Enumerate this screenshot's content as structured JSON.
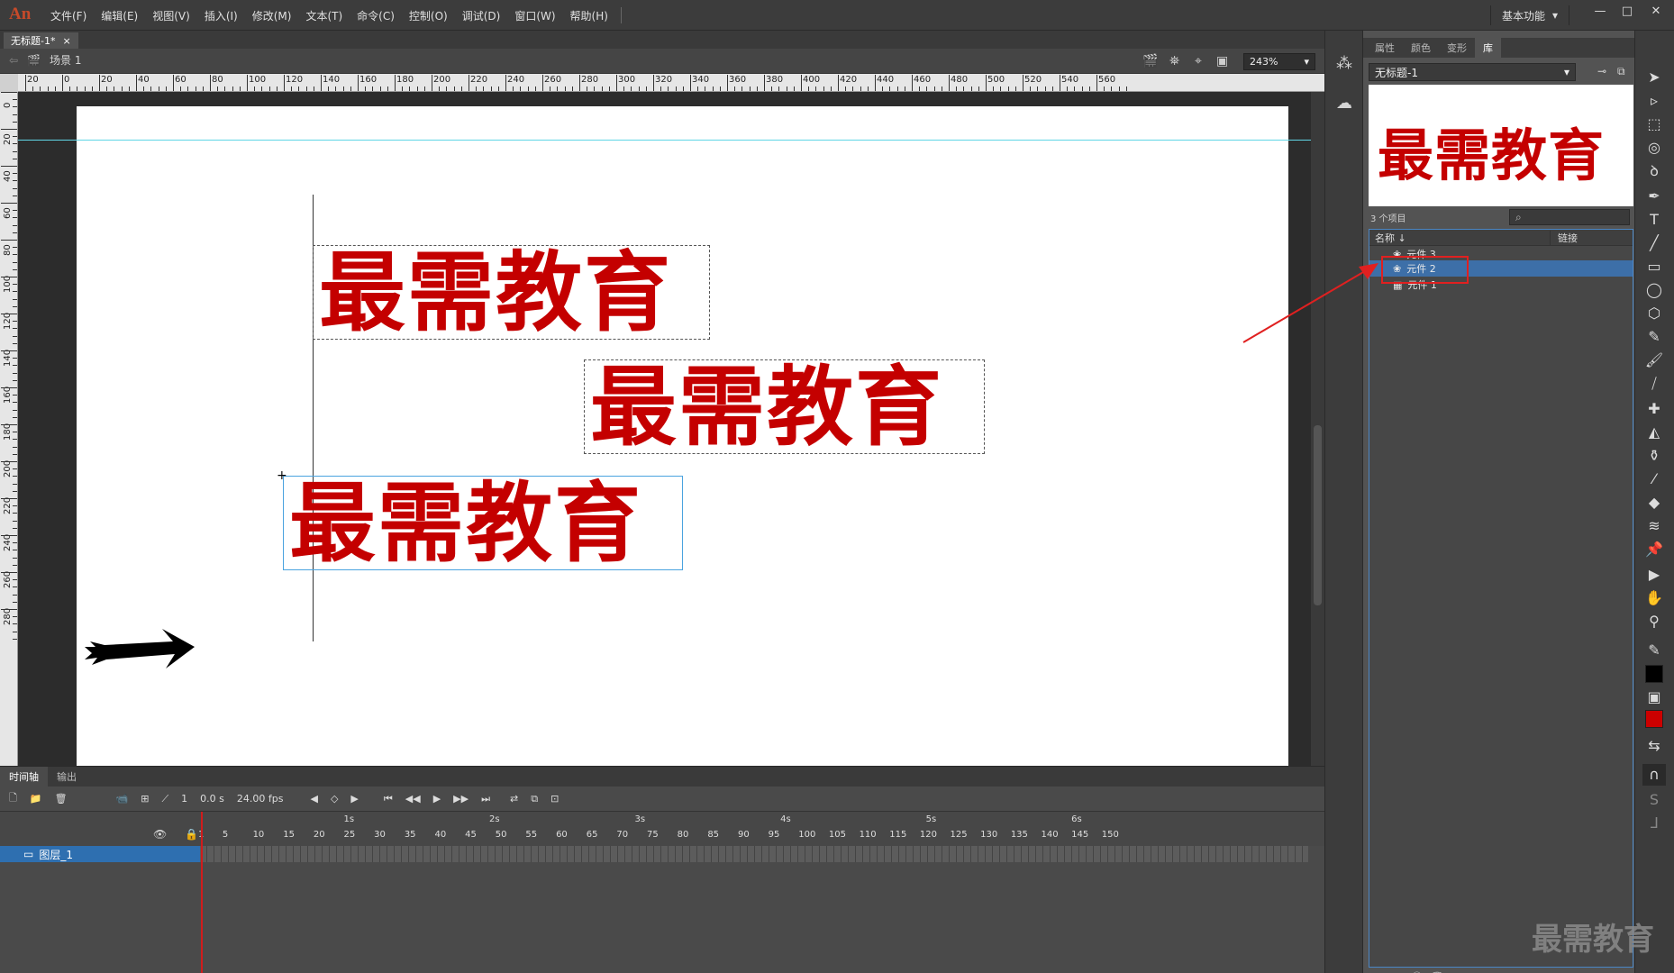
{
  "app": {
    "logo": "An",
    "menu": [
      "文件(F)",
      "编辑(E)",
      "视图(V)",
      "插入(I)",
      "修改(M)",
      "文本(T)",
      "命令(C)",
      "控制(O)",
      "调试(D)",
      "窗口(W)",
      "帮助(H)"
    ],
    "workspace": "基本功能",
    "workspace_arrow": "▾",
    "win_min": "—",
    "win_max": "□",
    "win_close": "✕"
  },
  "document": {
    "tab_title": "无标题-1*",
    "tab_close": "×",
    "scene": "场景 1",
    "zoom": "243%",
    "zoom_arrow": "▾"
  },
  "ruler": {
    "h_labels": [
      "20",
      "0",
      "20",
      "40",
      "60",
      "80",
      "100",
      "120",
      "140",
      "160",
      "180",
      "200",
      "220",
      "240",
      "260",
      "280",
      "300",
      "320",
      "340",
      "360",
      "380",
      "400",
      "420",
      "440",
      "460",
      "480",
      "500",
      "520",
      "540",
      "560"
    ],
    "v_labels": [
      "0",
      "20",
      "40",
      "60",
      "80",
      "100",
      "120",
      "140",
      "160",
      "180",
      "200",
      "220",
      "240",
      "260",
      "280"
    ]
  },
  "stage": {
    "instances": [
      {
        "text": "最需教育"
      },
      {
        "text": "最需教育"
      },
      {
        "text": "最需教育"
      }
    ]
  },
  "timeline": {
    "tabs": [
      "时间轴",
      "输出"
    ],
    "current_frame": "1",
    "time": "0.0 s",
    "fps": "24.00 fps",
    "seconds": [
      "1s",
      "2s",
      "3s",
      "4s",
      "5s",
      "6s"
    ],
    "frame_numbers": [
      "1",
      "5",
      "10",
      "15",
      "20",
      "25",
      "30",
      "35",
      "40",
      "45",
      "50",
      "55",
      "60",
      "65",
      "70",
      "75",
      "80",
      "85",
      "90",
      "95",
      "100",
      "105",
      "110",
      "115",
      "120",
      "125",
      "130",
      "135",
      "140",
      "145",
      "150"
    ],
    "layer_name": "图层_1"
  },
  "library": {
    "tabs": [
      "属性",
      "颜色",
      "变形",
      "库"
    ],
    "doc_name": "无标题-1",
    "doc_arrow": "▾",
    "preview_text": "最需教育",
    "item_count": "3 个项目",
    "col_name": "名称 ↓",
    "col_link": "链接",
    "items": [
      "元件 3",
      "元件 2",
      "元件 1"
    ],
    "selected_index": 1
  },
  "watermark": "最需教育",
  "colors": {
    "stroke": "#000000",
    "fill": "#cc0000",
    "text_red": "#c40000",
    "annotation": "#e02020"
  }
}
